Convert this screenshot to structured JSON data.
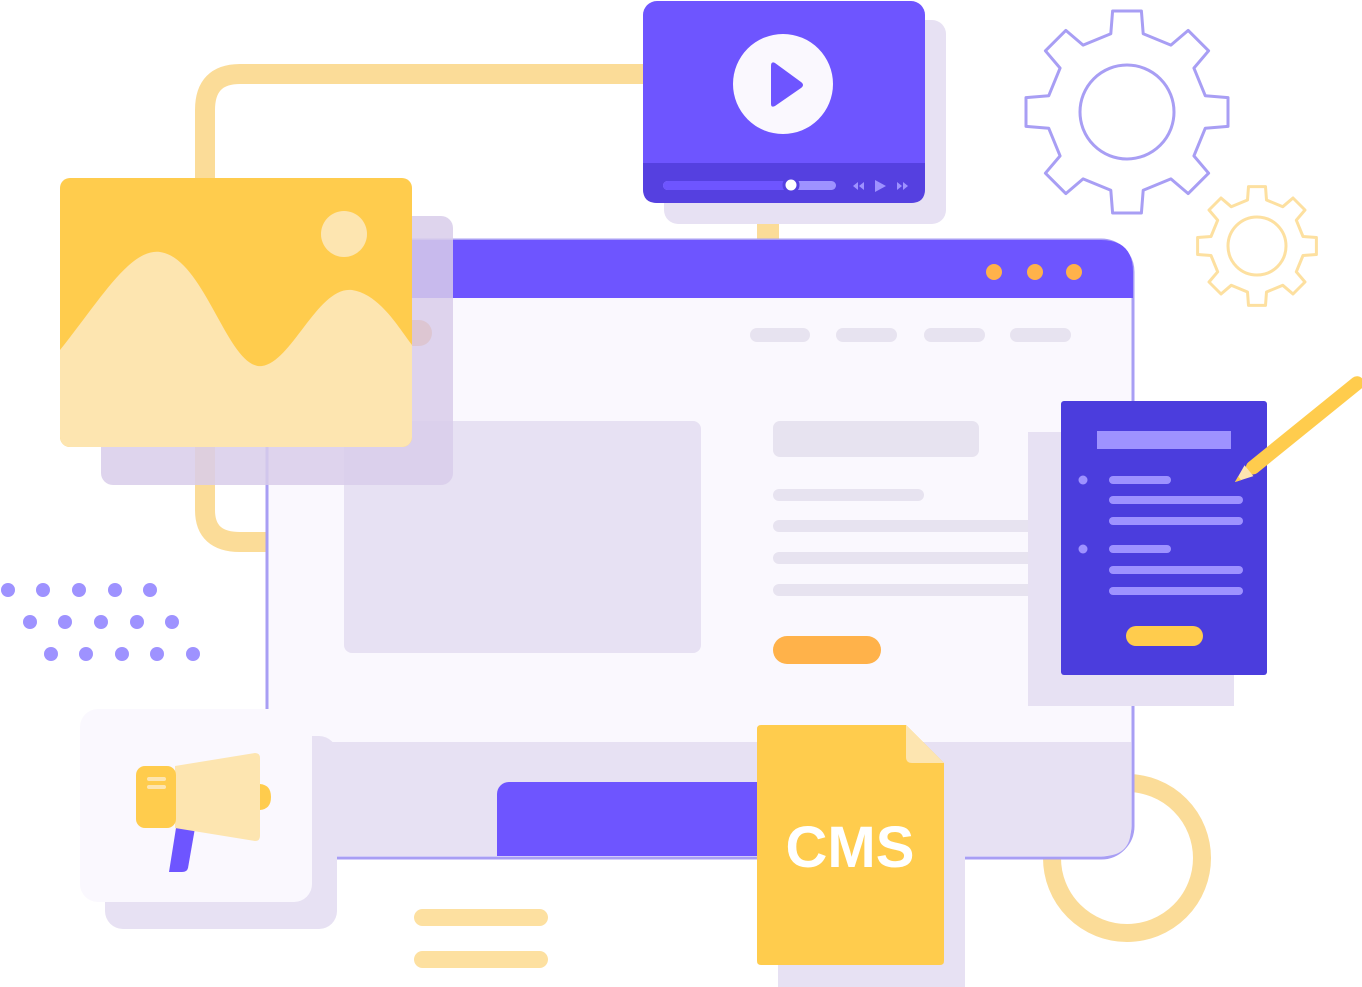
{
  "cms_file": {
    "label": "CMS"
  },
  "video_player": {
    "progress": 0.74,
    "controls": [
      "rewind-icon",
      "play-icon",
      "fast-forward-icon"
    ]
  },
  "browser_window": {
    "window_dots": 3,
    "nav_items": 4
  },
  "form_card": {
    "bullet_groups": 2
  },
  "icons": [
    "play-icon",
    "image-icon",
    "gear-icon",
    "megaphone-icon",
    "pencil-icon",
    "document-icon"
  ],
  "colors": {
    "primary_purple": "#6E55FF",
    "dark_purple": "#4B3DDD",
    "yellow": "#FFCC4D",
    "light_yellow": "#FDE5B0",
    "orange": "#FFB24A",
    "lavender": "#E8E1F3",
    "window_bg": "#FAF8FE",
    "light_gray": "#E7E3F0"
  }
}
